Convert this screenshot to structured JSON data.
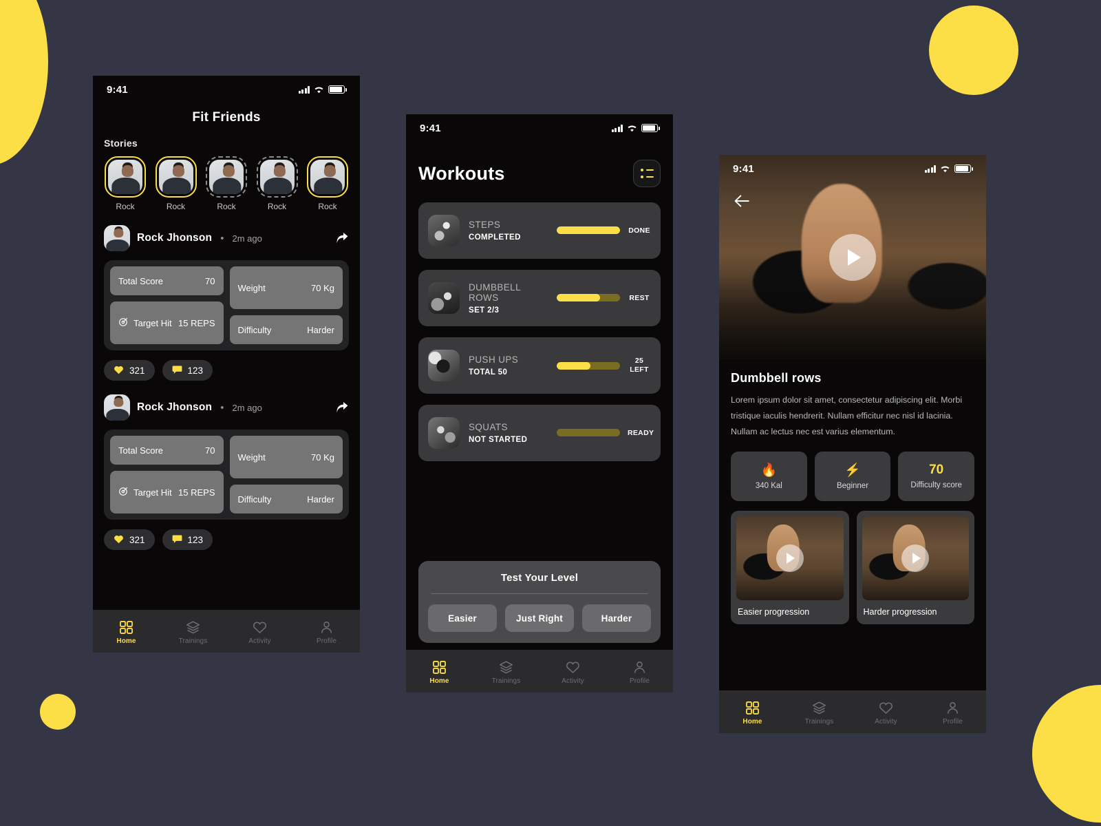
{
  "theme": {
    "accent": "#FCDE47",
    "background": "#343545",
    "phone_bg": "#0a0708"
  },
  "status_bar": {
    "time": "9:41"
  },
  "nav": {
    "items": [
      {
        "label": "Home",
        "icon": "grid-icon",
        "active": true
      },
      {
        "label": "Trainings",
        "icon": "layers-icon",
        "active": false
      },
      {
        "label": "Activity",
        "icon": "heart-icon",
        "active": false
      },
      {
        "label": "Profile",
        "icon": "person-icon",
        "active": false
      }
    ]
  },
  "phone1": {
    "title": "Fit Friends",
    "stories_label": "Stories",
    "stories": [
      {
        "name": "Rock",
        "ring": "seen"
      },
      {
        "name": "Rock",
        "ring": "seen"
      },
      {
        "name": "Rock",
        "ring": "unseen"
      },
      {
        "name": "Rock",
        "ring": "unseen"
      },
      {
        "name": "Rock",
        "ring": "seen"
      }
    ],
    "posts": [
      {
        "author": "Rock Jhonson",
        "separator": "•",
        "time": "2m ago",
        "stats": {
          "total_score_label": "Total Score",
          "total_score_value": "70",
          "target_hit_label": "Target Hit",
          "target_hit_value": "15 REPS",
          "weight_label": "Weight",
          "weight_value": "70 Kg",
          "difficulty_label": "Difficulty",
          "difficulty_value": "Harder"
        },
        "likes": "321",
        "comments": "123"
      },
      {
        "author": "Rock Jhonson",
        "separator": "•",
        "time": "2m ago",
        "stats": {
          "total_score_label": "Total Score",
          "total_score_value": "70",
          "target_hit_label": "Target Hit",
          "target_hit_value": "15 REPS",
          "weight_label": "Weight",
          "weight_value": "70 Kg",
          "difficulty_label": "Difficulty",
          "difficulty_value": "Harder"
        },
        "likes": "321",
        "comments": "123"
      }
    ]
  },
  "phone2": {
    "title": "Workouts",
    "menu_icon": "list-filter-icon",
    "workouts": [
      {
        "name": "STEPS",
        "sub": "COMPLETED",
        "progress": 100,
        "status": "DONE",
        "status2": ""
      },
      {
        "name": "DUMBBELL ROWS",
        "sub": "SET 2/3",
        "progress": 68,
        "status": "REST",
        "status2": ""
      },
      {
        "name": "PUSH UPS",
        "sub": "TOTAL 50",
        "progress": 53,
        "status": "25",
        "status2": "LEFT"
      },
      {
        "name": "SQUATS",
        "sub": "NOT STARTED",
        "progress": 0,
        "status": "READY",
        "status2": ""
      }
    ],
    "level": {
      "title": "Test Your Level",
      "buttons": [
        "Easier",
        "Just Right",
        "Harder"
      ]
    }
  },
  "phone3": {
    "back_icon": "arrow-left-icon",
    "play_icon": "play-icon",
    "title": "Dumbbell rows",
    "description": "Lorem ipsum dolor sit amet, consectetur adipiscing elit. Morbi tristique iaculis hendrerit. Nullam efficitur nec nisl id lacinia. Nullam ac lectus nec est varius elementum.",
    "stats": [
      {
        "icon": "🔥",
        "value": "",
        "label": "340 Kal"
      },
      {
        "icon": "⚡",
        "value": "",
        "label": "Beginner"
      },
      {
        "icon": "",
        "value": "70",
        "label": "Difficulty score"
      }
    ],
    "progressions": [
      {
        "caption": "Easier progression"
      },
      {
        "caption": "Harder progression"
      }
    ]
  }
}
